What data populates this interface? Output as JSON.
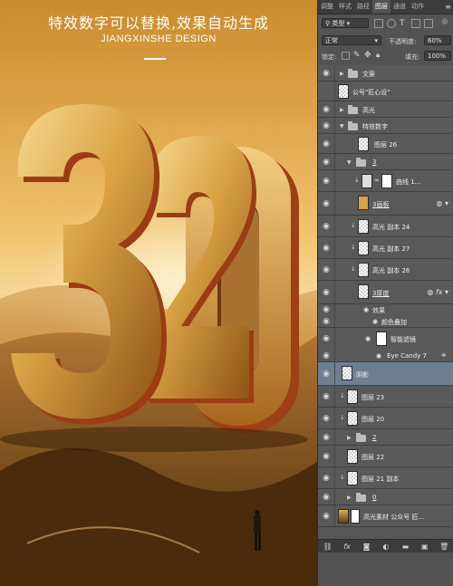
{
  "poster": {
    "headline": "特效数字可以替换,效果自动生成",
    "subline": "JIANGXINSHE DESIGN",
    "number_text": "320",
    "colors": {
      "gold_light": "#f7d88c",
      "gold_mid": "#d49a3a",
      "gold_dark": "#8a4d12",
      "edge": "#b4431a"
    }
  },
  "panel": {
    "tabs": [
      {
        "label": "调整",
        "active": false
      },
      {
        "label": "样式",
        "active": false
      },
      {
        "label": "路径",
        "active": false
      },
      {
        "label": "图层",
        "active": true
      },
      {
        "label": "通道",
        "active": false
      },
      {
        "label": "动作",
        "active": false
      }
    ],
    "filter": {
      "kind": "类型",
      "search_icon": "search-icon"
    },
    "blend_mode": "正常",
    "opacity_label": "不透明度:",
    "opacity_value": "60%",
    "lock_label": "锁定:",
    "fill_label": "填充:",
    "fill_value": "100%",
    "layers": [
      {
        "name": "文案",
        "kind": "group",
        "visible": true,
        "indent": 0,
        "expanded": false
      },
      {
        "name": "公号\"匠心设\"",
        "kind": "layer",
        "visible": false,
        "indent": 0,
        "thumb": "transparent"
      },
      {
        "name": "高光",
        "kind": "group",
        "visible": true,
        "indent": 0,
        "expanded": false
      },
      {
        "name": "特效数字",
        "kind": "group",
        "visible": true,
        "indent": 0,
        "expanded": true
      },
      {
        "name": "图层 26",
        "kind": "layer",
        "visible": true,
        "indent": 1,
        "thumb": "transparent"
      },
      {
        "name": "3",
        "kind": "group",
        "visible": true,
        "indent": 1,
        "expanded": true
      },
      {
        "name": "曲线 1...",
        "kind": "adjustment",
        "visible": true,
        "indent": 2,
        "clipped": true
      },
      {
        "name": "3画板",
        "kind": "smart",
        "visible": true,
        "indent": 2,
        "fx": true
      },
      {
        "name": "高光 副本 24",
        "kind": "layer",
        "visible": true,
        "indent": 2,
        "clipped": true,
        "thumb": "transparent"
      },
      {
        "name": "高光 副本 27",
        "kind": "layer",
        "visible": true,
        "indent": 2,
        "clipped": true,
        "thumb": "transparent"
      },
      {
        "name": "高光 副本 26",
        "kind": "layer",
        "visible": true,
        "indent": 2,
        "clipped": true,
        "thumb": "transparent"
      },
      {
        "name": "3厚度",
        "kind": "smart",
        "visible": true,
        "indent": 2,
        "fx": true
      },
      {
        "name": "效果",
        "kind": "effects",
        "visible": true,
        "indent": 3
      },
      {
        "name": "颜色叠加",
        "kind": "effect",
        "visible": true,
        "indent": 3
      },
      {
        "name": "智能滤镜",
        "kind": "filters",
        "visible": true,
        "indent": 3
      },
      {
        "name": "Eye Candy 7",
        "kind": "filter",
        "visible": true,
        "indent": 3
      },
      {
        "name": "阴影",
        "kind": "layer",
        "visible": true,
        "indent": 1,
        "selected": true,
        "thumb": "transparent"
      },
      {
        "name": "图层 23",
        "kind": "layer",
        "visible": true,
        "indent": 1,
        "clipped": true,
        "thumb": "transparent"
      },
      {
        "name": "图层 20",
        "kind": "layer",
        "visible": true,
        "indent": 1,
        "clipped": true,
        "thumb": "transparent"
      },
      {
        "name": "2",
        "kind": "group",
        "visible": true,
        "indent": 1,
        "expanded": false
      },
      {
        "name": "图层 22",
        "kind": "layer",
        "visible": true,
        "indent": 1,
        "thumb": "transparent"
      },
      {
        "name": "图层 21 副本",
        "kind": "layer",
        "visible": true,
        "indent": 1,
        "clipped": true,
        "thumb": "transparent"
      },
      {
        "name": "0",
        "kind": "group",
        "visible": true,
        "indent": 1,
        "expanded": false
      },
      {
        "name": "高光素材 公众号 匠...",
        "kind": "layer",
        "visible": true,
        "indent": 0,
        "thumb": "photo"
      }
    ],
    "bottom_icons": [
      "link-icon",
      "fx-icon",
      "mask-icon",
      "adjustment-icon",
      "folder-icon",
      "new-layer-icon",
      "trash-icon"
    ]
  }
}
